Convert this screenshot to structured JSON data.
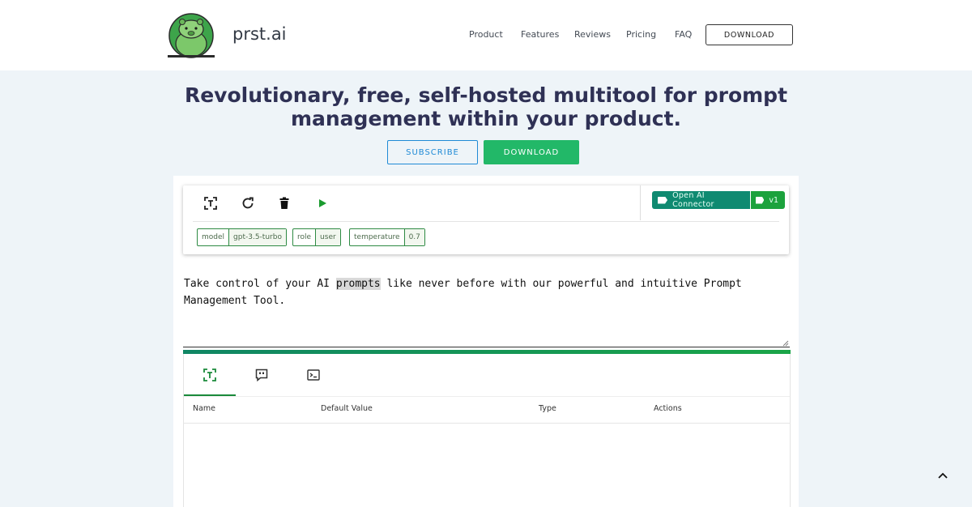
{
  "header": {
    "brand": "prst.ai",
    "nav": [
      {
        "label": "Product"
      },
      {
        "label": "Features"
      },
      {
        "label": "Reviews"
      },
      {
        "label": "Pricing"
      },
      {
        "label": "FAQ"
      }
    ],
    "download_label": "DOWNLOAD",
    "logo_icon": "capybara-logo-icon"
  },
  "hero": {
    "title_line1": "Revolutionary, free, self-hosted multitool for prompt",
    "title_line2": "management within your product.",
    "subscribe_label": "SUBSCRIBE",
    "download_label": "DOWNLOAD"
  },
  "toolbar": {
    "icons": [
      "text-variable-icon",
      "refresh-icon",
      "trash-icon",
      "play-icon"
    ],
    "connector": {
      "name": "Open AI Connector",
      "version": "v1"
    },
    "params": [
      {
        "key": "model",
        "value": "gpt-3.5-turbo"
      },
      {
        "key": "role",
        "value": "user"
      },
      {
        "key": "temperature",
        "value": "0.7"
      }
    ]
  },
  "prompt": {
    "before": "Take control of your AI ",
    "highlight": "prompts",
    "after": " like never before with our powerful and intuitive Prompt",
    "line2": "Management Tool."
  },
  "tabs": {
    "items": [
      "variables-tab",
      "messages-tab",
      "console-tab"
    ],
    "active": 0
  },
  "table": {
    "columns": [
      "Name",
      "Default Value",
      "Type",
      "Actions"
    ]
  },
  "colors": {
    "accent_green": "#22b868",
    "accent_blue": "#1f8ad6",
    "title_navy": "#2f3155",
    "connector_teal": "#0f8a71",
    "connector_green": "#1ca23d"
  }
}
